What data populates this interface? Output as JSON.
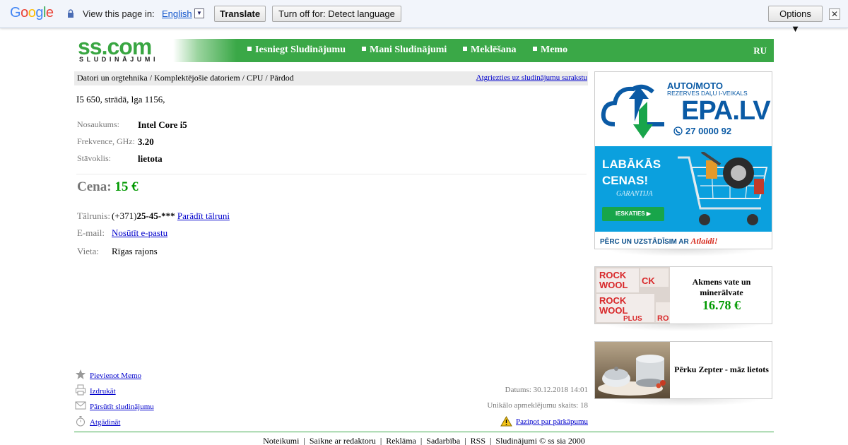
{
  "translate_bar": {
    "logo": "Google",
    "view_text": "View this page in:",
    "language": "English",
    "dropdown_glyph": "▼",
    "translate_label": "Translate",
    "turn_off_label": "Turn off for: Detect language",
    "options_label": "Options ▼",
    "close_glyph": "✕"
  },
  "header": {
    "logo_main": "ss.com",
    "logo_sub": "SLUDINĀJUMI",
    "menu": [
      "Iesniegt Sludinājumu",
      "Mani Sludinājumi",
      "Meklēšana",
      "Memo"
    ],
    "lang_switch": "RU"
  },
  "breadcrumb": {
    "path": "Datori un orgtehnika / Komplektējošie datoriem / CPU / Pārdod",
    "back_link": "Atgriezties uz sludinājumu sarakstu"
  },
  "listing": {
    "description": "I5 650, strādā, lga 1156,",
    "options": [
      {
        "label": "Nosaukums:",
        "value": "Intel Core i5"
      },
      {
        "label": "Frekvence, GHz:",
        "value": "3.20"
      },
      {
        "label": "Stāvoklis:",
        "value": "lietota"
      }
    ],
    "price_label": "Cena:",
    "price_value": "15 €",
    "phone_label": "Tālrunis:",
    "phone_prefix": "(+371)",
    "phone_masked": "25-45-***",
    "phone_show": "Parādīt tālruni",
    "email_label": "E-mail:",
    "email_link": "Nosūtīt e-pastu",
    "place_label": "Vieta:",
    "place_value": "Rīgas rajons"
  },
  "actions": {
    "memo": "Pievienot Memo",
    "print": "Izdrukāt",
    "forward": "Pārsūtīt sludinājumu",
    "remind": "Atgādināt",
    "date": "Datums: 30.12.2018 14:01",
    "views": "Unikālo apmeklējumu skaits: 18",
    "report": "Paziņot par pārkāpumu"
  },
  "footer": "Noteikumi  |  Saikne ar redaktoru  |  Reklāma  |  Sadarbība  |  RSS  |  Sludinājumi © ss sia 2000",
  "ads": {
    "banner": {
      "auto_moto": "AUTO/MOTO",
      "rezerves": "REZERVES DAĻU I-VEIKALS",
      "brand": "EPA.LV",
      "phone": "27 0000 92",
      "headline_1": "LABĀKĀS",
      "headline_2": "CENAS!",
      "guarantee": "GARANTIJA",
      "cta": "IESKATIES ▶",
      "bottom_prefix": "PĒRC UN UZSTĀDĪSIM AR ",
      "bottom_brand": "Atlaidi!"
    },
    "small_1": {
      "title": "Akmens vate un minerālvate",
      "price": "16.78 €",
      "image_text": "ROCK WOOL"
    },
    "small_2": {
      "title": "Pērku Zepter - māz lietots"
    }
  },
  "colors": {
    "brand_green": "#3aa847",
    "price_green": "#009900",
    "link_blue": "#0000cc",
    "label_gray": "#777777"
  }
}
